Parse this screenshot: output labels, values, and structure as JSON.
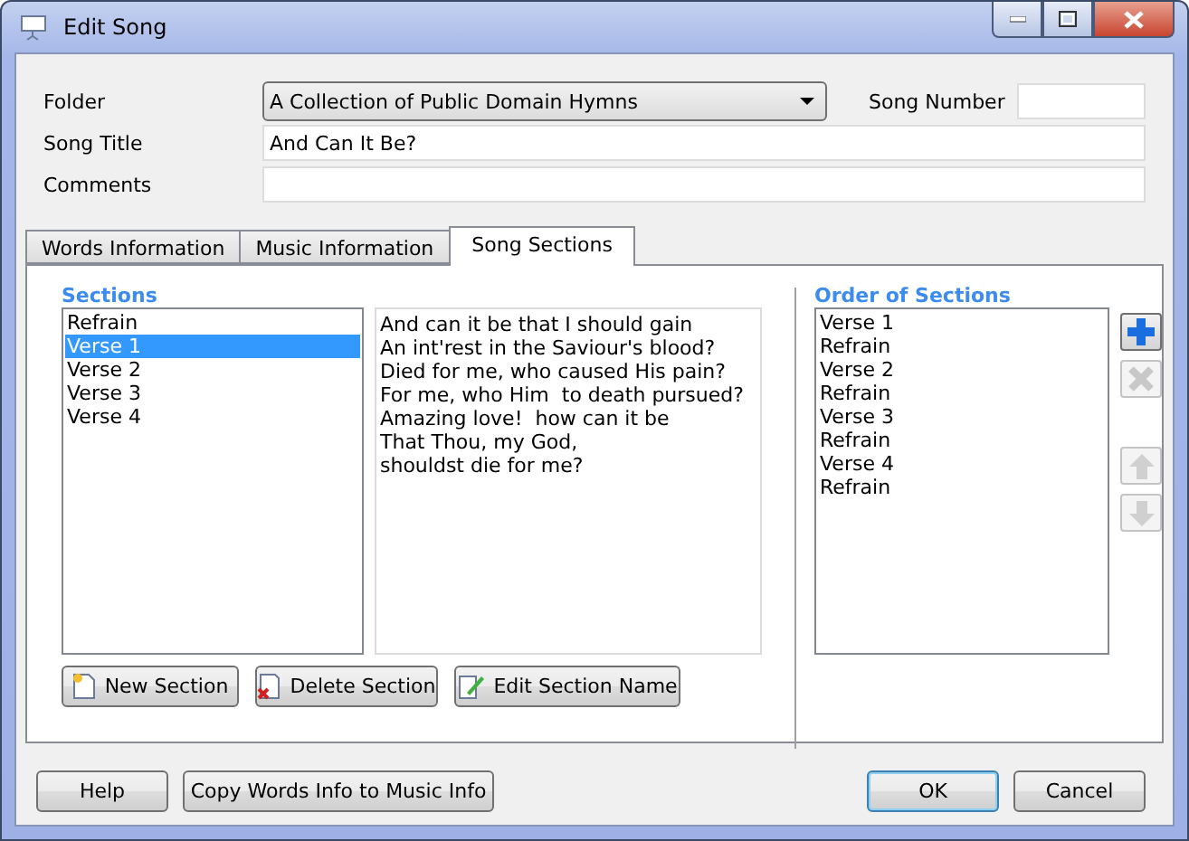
{
  "window": {
    "title": "Edit Song"
  },
  "fields": {
    "folder": {
      "label": "Folder",
      "value": "A Collection of Public Domain Hymns"
    },
    "song_number": {
      "label": "Song Number"
    },
    "song_title": {
      "label": "Song Title",
      "value": "And Can It Be?"
    },
    "comments": {
      "label": "Comments"
    }
  },
  "tabs": [
    {
      "label": "Words Information",
      "selected": false
    },
    {
      "label": "Music Information",
      "selected": false
    },
    {
      "label": "Song Sections",
      "selected": true
    }
  ],
  "sections": {
    "heading": "Sections",
    "items": [
      {
        "label": "Refrain",
        "selected": false
      },
      {
        "label": "Verse 1",
        "selected": true
      },
      {
        "label": "Verse 2",
        "selected": false
      },
      {
        "label": "Verse 3",
        "selected": false
      },
      {
        "label": "Verse 4",
        "selected": false
      }
    ],
    "lyrics": [
      "And can it be that I should gain",
      "An int'rest in the Saviour's blood?",
      "Died for me, who caused His pain?",
      "For me, who Him  to death pursued?",
      "Amazing love!  how can it be",
      "That Thou, my God,",
      "shouldst die for me?"
    ]
  },
  "order": {
    "heading": "Order of Sections",
    "items": [
      "Verse 1",
      "Refrain",
      "Verse 2",
      "Refrain",
      "Verse 3",
      "Refrain",
      "Verse 4",
      "Refrain"
    ],
    "tools": [
      {
        "kind": "add",
        "disabled": false
      },
      {
        "kind": "remove",
        "disabled": true
      },
      {
        "kind": "up",
        "disabled": true
      },
      {
        "kind": "down",
        "disabled": true
      }
    ]
  },
  "section_buttons": [
    {
      "kind": "new",
      "label": "New Section"
    },
    {
      "kind": "delete",
      "label": "Delete Section"
    },
    {
      "kind": "edit",
      "label": "Edit Section Name"
    }
  ],
  "footer_buttons": [
    {
      "label": "Help",
      "default": false
    },
    {
      "label": "Copy Words Info to Music Info",
      "default": false
    },
    {
      "label": "OK",
      "default": true
    },
    {
      "label": "Cancel",
      "default": false
    }
  ]
}
